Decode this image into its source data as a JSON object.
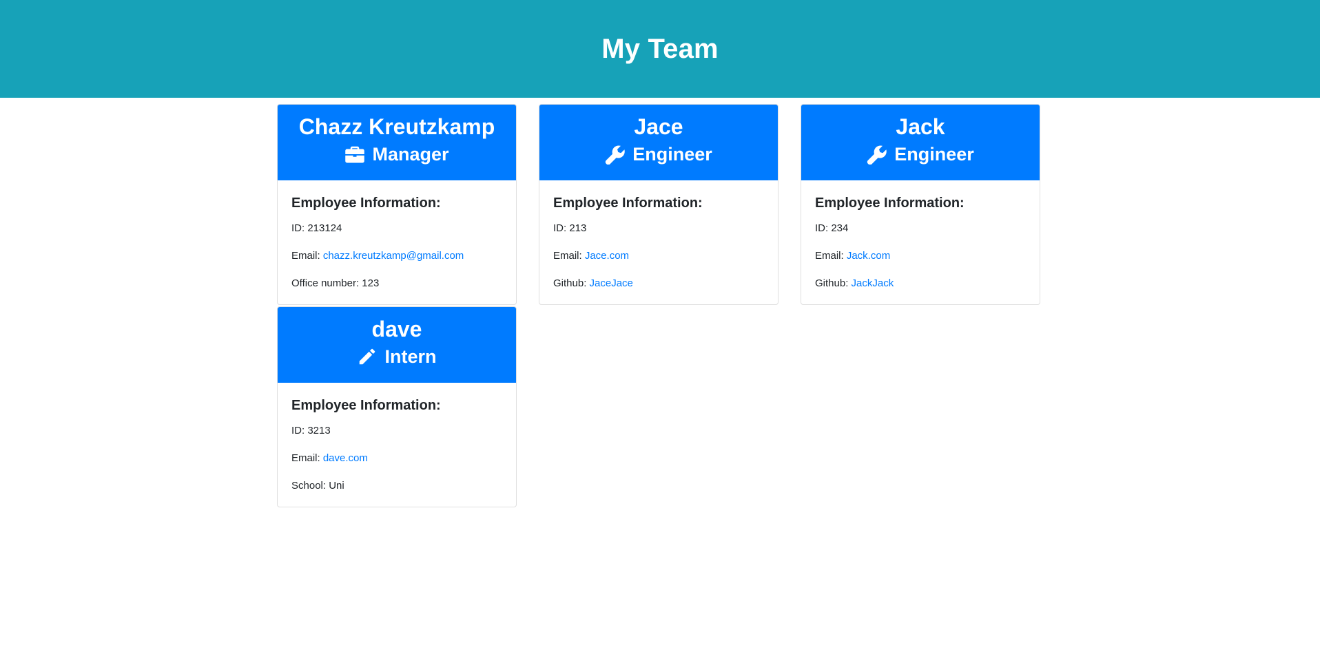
{
  "header": {
    "title": "My Team"
  },
  "info_heading": "Employee Information:",
  "employees": [
    {
      "name": "Chazz Kreutzkamp",
      "role": "Manager",
      "icon": "briefcase-icon",
      "id_label": "ID: ",
      "id": "213124",
      "email_label": "Email: ",
      "email": "chazz.kreutzkamp@gmail.com",
      "extra_label": "Office number: ",
      "extra_value": "123"
    },
    {
      "name": "Jace",
      "role": "Engineer",
      "icon": "wrench-icon",
      "id_label": "ID: ",
      "id": "213",
      "email_label": "Email: ",
      "email": "Jace.com",
      "extra_label": "Github: ",
      "extra_value": "JaceJace"
    },
    {
      "name": "Jack",
      "role": "Engineer",
      "icon": "wrench-icon",
      "id_label": "ID: ",
      "id": "234",
      "email_label": "Email: ",
      "email": "Jack.com",
      "extra_label": "Github: ",
      "extra_value": "JackJack"
    },
    {
      "name": "dave",
      "role": "Intern",
      "icon": "pencil-icon",
      "id_label": "ID: ",
      "id": "3213",
      "email_label": "Email: ",
      "email": "dave.com",
      "extra_label": "School: ",
      "extra_value": "Uni"
    }
  ],
  "colors": {
    "header_bg": "#17a2b8",
    "card_header_bg": "#007bff",
    "link": "#007bff"
  }
}
